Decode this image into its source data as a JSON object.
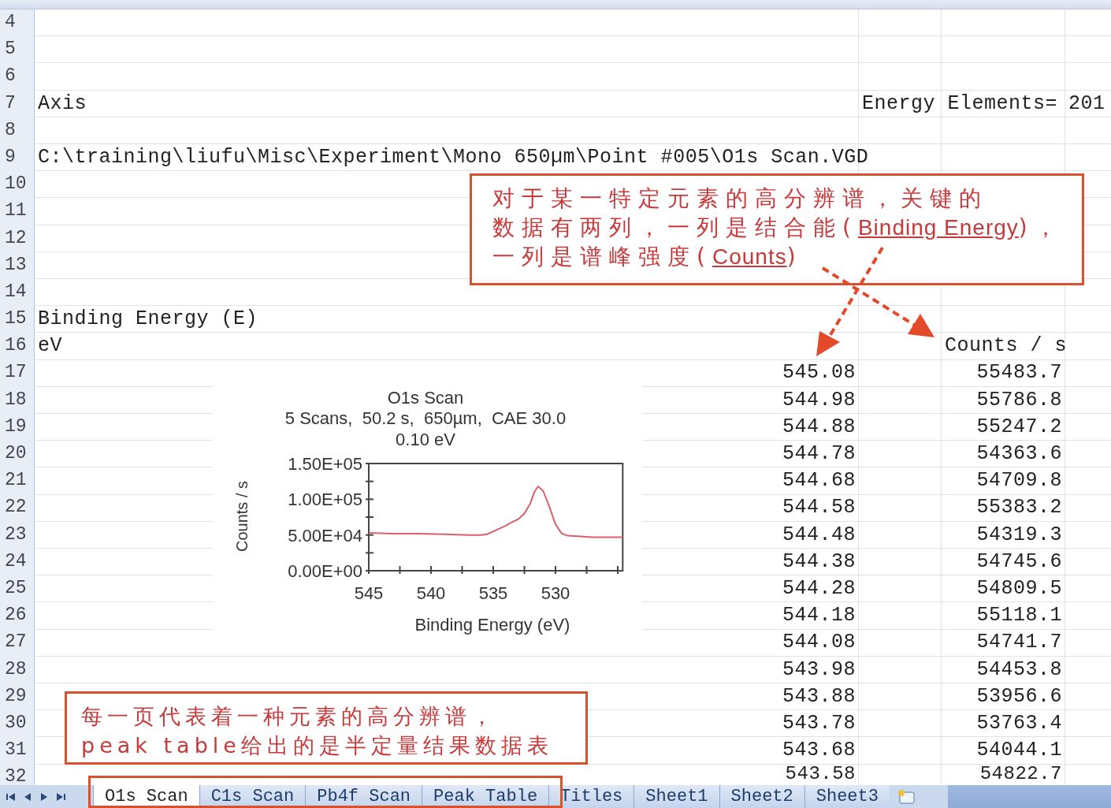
{
  "rows": [
    {
      "row": "4"
    },
    {
      "row": "5"
    },
    {
      "row": "6"
    },
    {
      "row": "7",
      "kind": "text",
      "column_1": "Axis",
      "column_2": "Energy Elements=",
      "column_4": "201"
    },
    {
      "row": "8"
    },
    {
      "row": "9",
      "kind": "text",
      "column_1": "C:\\training\\liufu\\Misc\\Experiment\\Mono 650µm\\Point #005\\O1s Scan.VGD"
    },
    {
      "row": "10"
    },
    {
      "row": "11"
    },
    {
      "row": "12"
    },
    {
      "row": "13"
    },
    {
      "row": "14"
    },
    {
      "row": "15",
      "kind": "text",
      "column_1": "Binding Energy (E)"
    },
    {
      "row": "16",
      "kind": "text",
      "column_1": "eV",
      "column_3": "Counts / s"
    },
    {
      "row": "17",
      "kind": "numbers",
      "column_1": "545.08",
      "column_3": "55483.7"
    },
    {
      "row": "18",
      "kind": "numbers",
      "column_1": "544.98",
      "column_3": "55786.8"
    },
    {
      "row": "19",
      "kind": "numbers",
      "column_1": "544.88",
      "column_3": "55247.2"
    },
    {
      "row": "20",
      "kind": "numbers",
      "column_1": "544.78",
      "column_3": "54363.6"
    },
    {
      "row": "21",
      "kind": "numbers",
      "column_1": "544.68",
      "column_3": "54709.8"
    },
    {
      "row": "22",
      "kind": "numbers",
      "column_1": "544.58",
      "column_3": "55383.2"
    },
    {
      "row": "23",
      "kind": "numbers",
      "column_1": "544.48",
      "column_3": "54319.3"
    },
    {
      "row": "24",
      "kind": "numbers",
      "column_1": "544.38",
      "column_3": "54745.6"
    },
    {
      "row": "25",
      "kind": "numbers",
      "column_1": "544.28",
      "column_3": "54809.5"
    },
    {
      "row": "26",
      "kind": "numbers",
      "column_1": "544.18",
      "column_3": "55118.1"
    },
    {
      "row": "27",
      "kind": "numbers",
      "column_1": "544.08",
      "column_3": "54741.7"
    },
    {
      "row": "28",
      "kind": "numbers",
      "column_1": "543.98",
      "column_3": "54453.8"
    },
    {
      "row": "29",
      "kind": "numbers",
      "column_1": "543.88",
      "column_3": "53956.6"
    },
    {
      "row": "30",
      "kind": "numbers",
      "column_1": "543.78",
      "column_3": "53763.4"
    },
    {
      "row": "31",
      "kind": "numbers",
      "column_1": "543.68",
      "column_3": "54044.1"
    },
    {
      "row": "32",
      "kind": "numbers",
      "column_1": "543.58",
      "column_3": "54822.7"
    }
  ],
  "chart": {
    "subtitles": [
      "5 Scans,  50.2 s,  650µm,  CAE 30.0",
      "0.10 eV"
    ],
    "chart_data": {
      "type": "line",
      "title": "O1s Scan",
      "xlabel": "Binding Energy (eV)",
      "ylabel": "Counts / s",
      "x": [
        545,
        543,
        541,
        539,
        537,
        536,
        535.5,
        535,
        534,
        533.5,
        533,
        532.5,
        532,
        531.7,
        531.4,
        531,
        530.5,
        530,
        529.5,
        529,
        528,
        527,
        526,
        524.6
      ],
      "series": [
        {
          "color": "#d9606a",
          "values": [
            53000,
            52000,
            52000,
            51000,
            50000,
            50000,
            51000,
            55000,
            63000,
            68000,
            72000,
            80000,
            95000,
            110000,
            118000,
            112000,
            90000,
            65000,
            52000,
            49000,
            48000,
            47000,
            47000,
            47000
          ]
        }
      ],
      "xlim": [
        545,
        524.6
      ],
      "ylim": [
        0,
        150000
      ],
      "xticks": [
        545,
        540,
        535,
        530
      ],
      "yticks": [
        {
          "value": 0,
          "label": "0.00E+00"
        },
        {
          "value": 50000,
          "label": "5.00E+04"
        },
        {
          "value": 100000,
          "label": "1.00E+05"
        },
        {
          "value": 150000,
          "label": "1.50E+05"
        }
      ]
    }
  },
  "annotations": [
    {
      "lines": [
        [
          {
            "text": "对于某一特定元素的高分辨谱，关键的",
            "underlined": false
          }
        ],
        [
          {
            "text": "数据有两列，一列是结合能(",
            "underlined": false
          },
          {
            "text": "Binding Energy",
            "underlined": true
          },
          {
            "text": ")，",
            "underlined": false
          }
        ],
        [
          {
            "text": "一列是谱峰强度(",
            "underlined": false
          },
          {
            "text": "Counts",
            "underlined": true
          },
          {
            "text": ")",
            "underlined": false
          }
        ]
      ]
    },
    {
      "lines": [
        [
          {
            "text": "每一页代表着一种元素的高分辨谱，",
            "underlined": false
          }
        ],
        [
          {
            "text": "peak table给出的是半定量结果数据表",
            "underlined": false
          }
        ]
      ]
    }
  ],
  "sheet_tabs": [
    {
      "label": "O1s Scan",
      "selected": true
    },
    {
      "label": "C1s Scan",
      "selected": false
    },
    {
      "label": "Pb4f Scan",
      "selected": false
    },
    {
      "label": "Peak Table",
      "selected": false
    },
    {
      "label": "Titles",
      "selected": false
    },
    {
      "label": "Sheet1",
      "selected": false
    },
    {
      "label": "Sheet2",
      "selected": false
    },
    {
      "label": "Sheet3",
      "selected": false
    }
  ]
}
